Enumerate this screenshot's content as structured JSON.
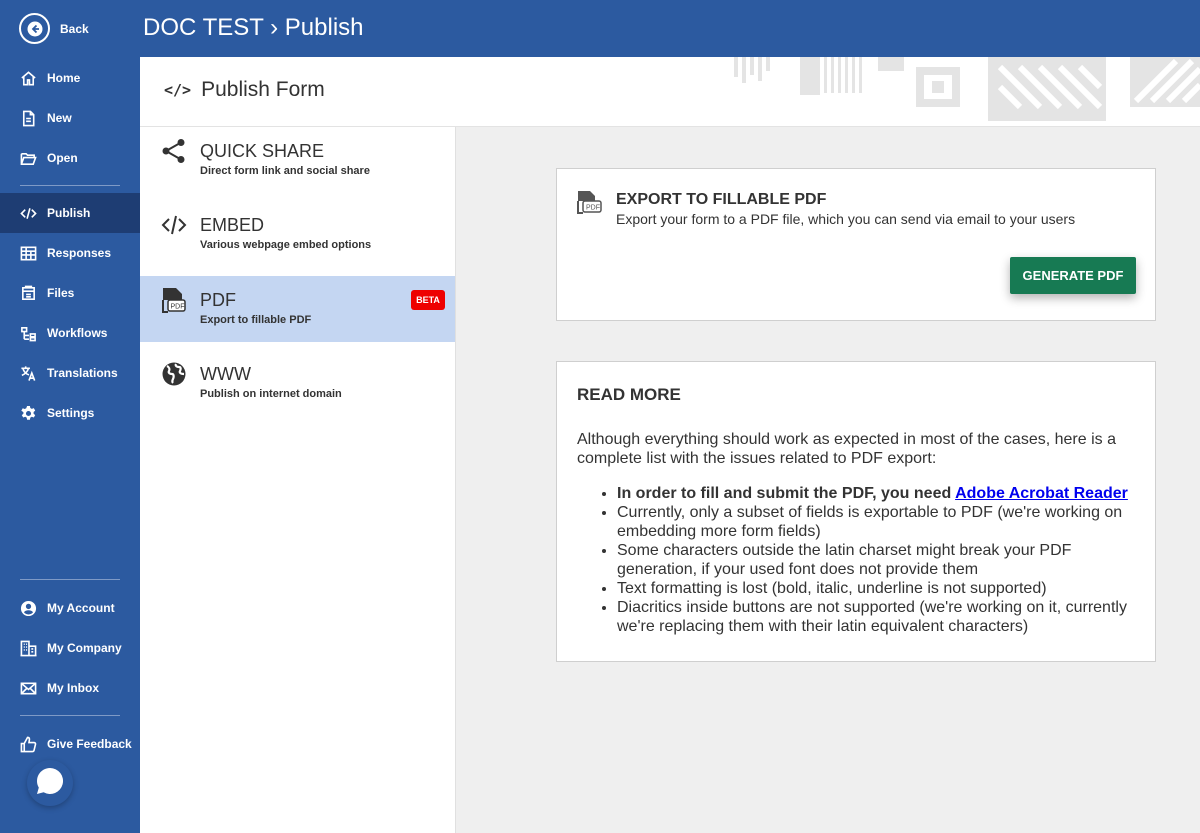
{
  "nav": {
    "back": "Back",
    "items": [
      {
        "label": "Home",
        "icon": "home-icon"
      },
      {
        "label": "New",
        "icon": "new-file-icon"
      },
      {
        "label": "Open",
        "icon": "folder-open-icon"
      },
      {
        "label": "Publish",
        "icon": "code-icon"
      },
      {
        "label": "Responses",
        "icon": "responses-table-icon"
      },
      {
        "label": "Files",
        "icon": "files-icon"
      },
      {
        "label": "Workflows",
        "icon": "workflow-icon"
      },
      {
        "label": "Translations",
        "icon": "translate-icon"
      },
      {
        "label": "Settings",
        "icon": "gear-icon"
      },
      {
        "label": "My Account",
        "icon": "user-icon"
      },
      {
        "label": "My Company",
        "icon": "company-icon"
      },
      {
        "label": "My Inbox",
        "icon": "mail-icon"
      },
      {
        "label": "Give Feedback",
        "icon": "thumbs-up-icon"
      }
    ],
    "active": "Publish"
  },
  "header": {
    "title": "DOC TEST › Publish"
  },
  "subheader": {
    "title": "Publish Form"
  },
  "methods": [
    {
      "title": "QUICK SHARE",
      "subtitle": "Direct form link and social share",
      "icon": "share-icon"
    },
    {
      "title": "EMBED",
      "subtitle": "Various webpage embed options",
      "icon": "code-icon"
    },
    {
      "title": "PDF",
      "subtitle": "Export to fillable PDF",
      "icon": "pdf-file-icon",
      "badge": "BETA"
    },
    {
      "title": "WWW",
      "subtitle": "Publish on internet domain",
      "icon": "globe-icon"
    }
  ],
  "export_card": {
    "title": "EXPORT TO FILLABLE PDF",
    "subtitle": "Export your form to a PDF file, which you can send via email to your users",
    "button": "GENERATE PDF"
  },
  "read_more": {
    "title": "READ MORE",
    "intro": "Although everything should work as expected in most of the cases, here is a complete list with the issues related to PDF export:",
    "first_item_text": "In order to fill and submit the PDF, you need ",
    "first_item_link": "Adobe Acrobat Reader",
    "items": [
      "Currently, only a subset of fields is exportable to PDF (we're working on embedding more form fields)",
      "Some characters outside the latin charset might break your PDF generation, if your used font does not provide them",
      "Text formatting is lost (bold, italic, underline is not supported)",
      "Diacritics inside buttons are not supported (we're working on it, currently we're replacing them with their latin equivalent characters)"
    ]
  },
  "colors": {
    "primary": "#2c5aa0",
    "active_nav": "#1e3d73",
    "active_method": "#c4d6f2",
    "button": "#177a53",
    "badge": "#ee0000"
  }
}
